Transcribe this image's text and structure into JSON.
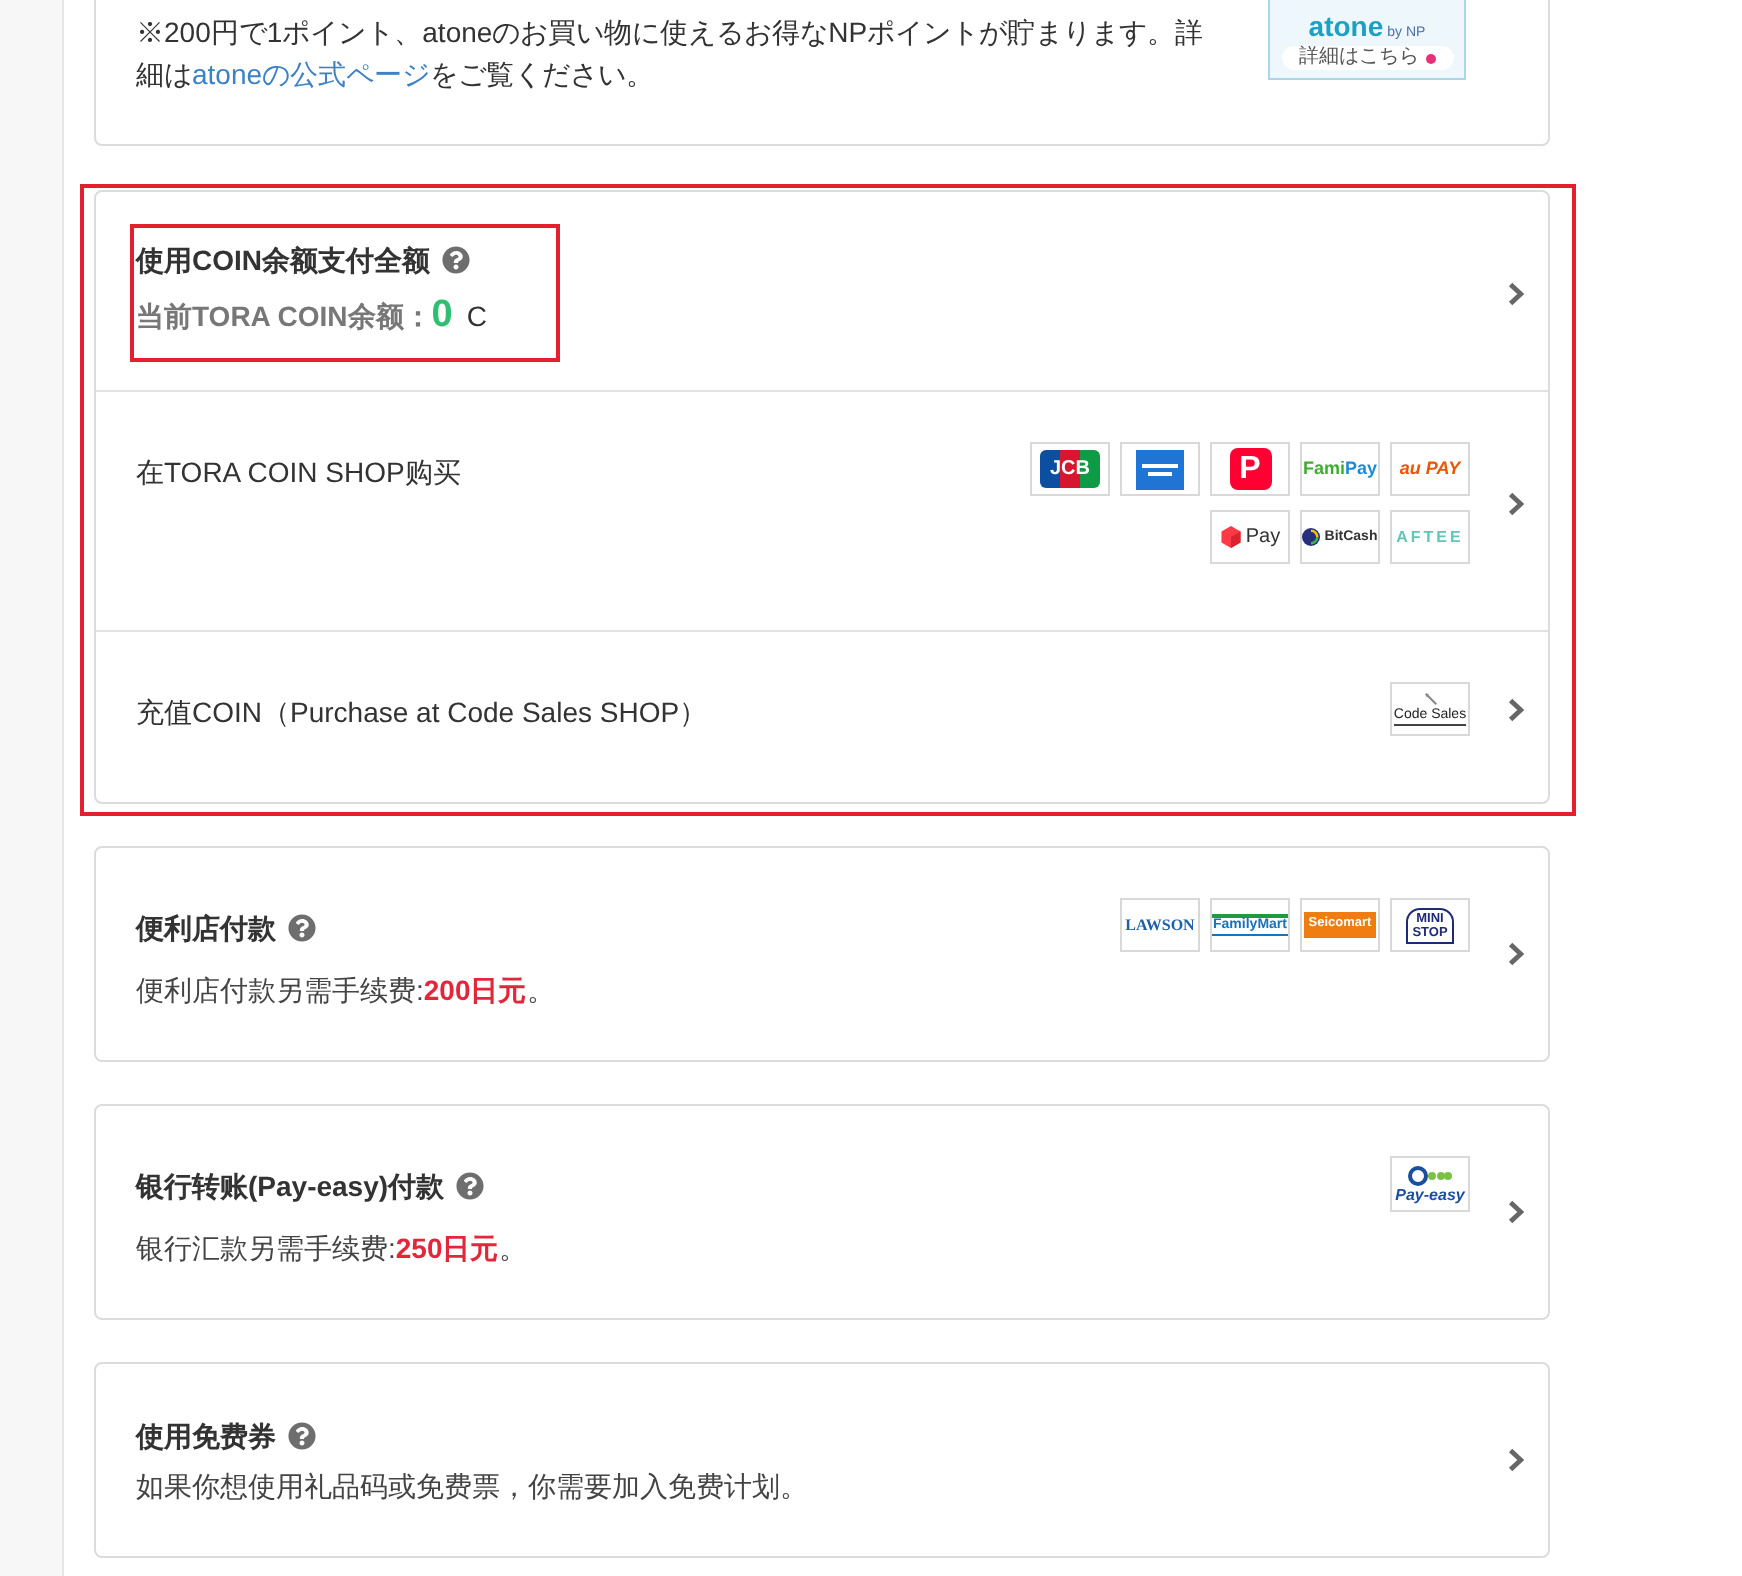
{
  "atone_notice": {
    "text_before": "※200円で1ポイント、atoneのお買い物に使えるお得なNPポイントが貯まります。詳細は",
    "link": "atoneの公式ページ",
    "text_after": "をご覧ください。",
    "logo": {
      "name": "atone",
      "suffix": "by NP",
      "button": "詳細はこちら"
    }
  },
  "coin_payment": {
    "highlighted": true,
    "options": [
      {
        "kind": "balance",
        "title": "使用COIN余额支付全额",
        "help": true,
        "highlighted": true,
        "balance_label": "当前TORA COIN余额：",
        "balance_value": "0",
        "balance_unit": "C"
      },
      {
        "kind": "shop",
        "title": "在TORA COIN SHOP购买",
        "logos": [
          {
            "kind": "jcb",
            "label": "JCB"
          },
          {
            "kind": "amex"
          },
          {
            "kind": "paypay",
            "label": "P"
          },
          {
            "kind": "famipay",
            "label": "FamiPay"
          },
          {
            "kind": "aupay",
            "label": "au PAY"
          },
          {
            "kind": "merpay",
            "label": "Pay"
          },
          {
            "kind": "bitcash",
            "label": "BitCash"
          },
          {
            "kind": "aftee",
            "label": "AFTEE"
          }
        ]
      },
      {
        "kind": "shop",
        "title": "充值COIN（Purchase at Code Sales SHOP）",
        "logos": [
          {
            "kind": "codesales",
            "label": "Code Sales"
          }
        ]
      }
    ]
  },
  "payment_methods": [
    {
      "title": "便利店付款",
      "help": true,
      "note_before": "便利店付款另需手续费:",
      "fee": "200日元",
      "note_after": "。",
      "logos": [
        {
          "kind": "lawson",
          "label": "LAWSON"
        },
        {
          "kind": "familymart",
          "label": "FamilyMart"
        },
        {
          "kind": "seicomart",
          "label": "Seicomart"
        },
        {
          "kind": "ministop",
          "label": "MINI STOP"
        }
      ]
    },
    {
      "title": "银行转账(Pay-easy)付款",
      "help": true,
      "note_before": "银行汇款另需手续费:",
      "fee": "250日元",
      "note_after": "。",
      "logos": [
        {
          "kind": "payeasy",
          "label": "Pay-easy"
        }
      ]
    },
    {
      "title": "使用免费券",
      "help": true,
      "note_before": "如果你想使用礼品码或免费票，你需要加入免费计划。"
    }
  ]
}
